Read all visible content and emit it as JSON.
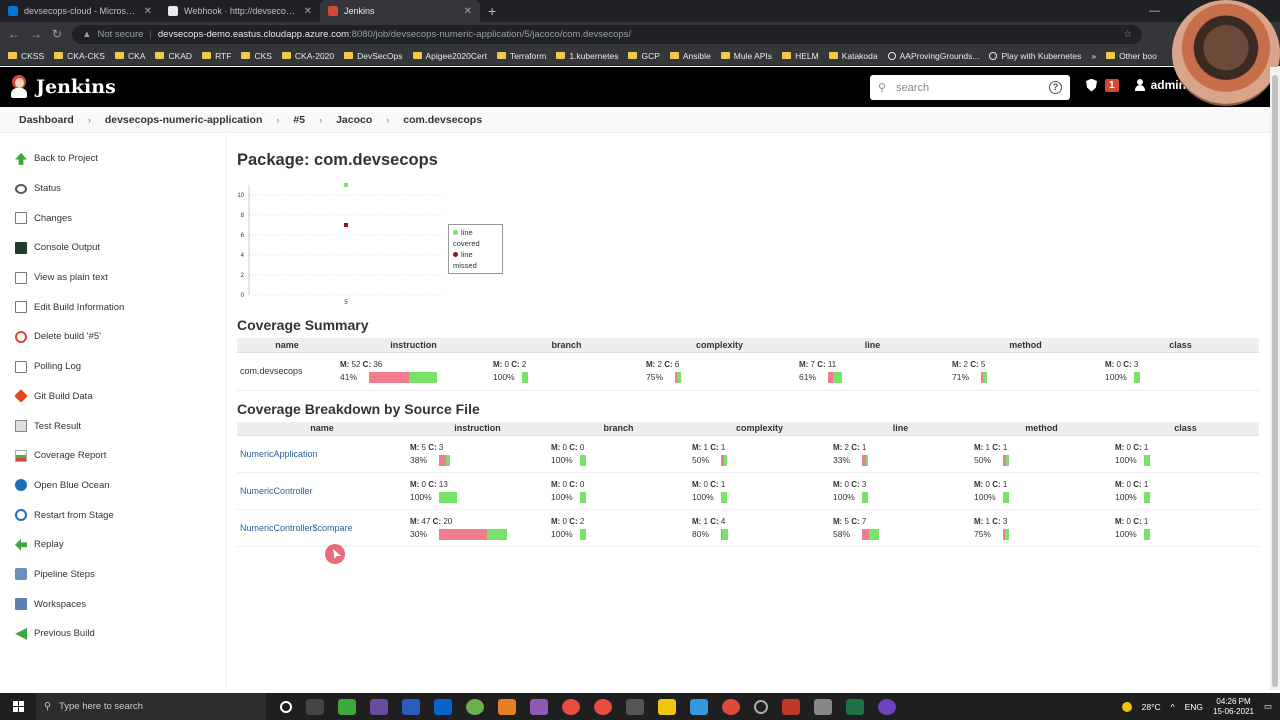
{
  "browser": {
    "tabs": [
      {
        "title": "devsecops-cloud - Microsoft Az",
        "color": "#0078d4",
        "active": false
      },
      {
        "title": "Webhook · http://devsecops-de",
        "color": "#e8eaed",
        "active": false
      },
      {
        "title": "Jenkins",
        "color": "#d24939",
        "active": true
      }
    ],
    "new_tab": "+",
    "security": "Not secure",
    "url_host": "devsecops-demo.eastus.cloudapp.azure.com",
    "url_path": ":8080/job/devsecops-numeric-application/5/jacoco/com.devsecops/",
    "bookmarks": [
      "CKSS",
      "CKA-CKS",
      "CKA",
      "CKAD",
      "RTF",
      "CKS",
      "CKA-2020",
      "DevSecOps",
      "Apigee2020Cert",
      "Terraform",
      "1.kubernetes",
      "GCP",
      "Ansible",
      "Mule APIs",
      "HELM",
      "Katakoda",
      "AAProvingGrounds...",
      "Play with Kubernetes"
    ],
    "bookmarks_more": "»",
    "bookmarks_other": "Other boo"
  },
  "jenkins": {
    "brand": "Jenkins",
    "search_placeholder": "search",
    "help": "?",
    "alerts_count": "1",
    "user": "admin"
  },
  "breadcrumb": [
    "Dashboard",
    "devsecops-numeric-application",
    "#5",
    "Jacoco",
    "com.devsecops"
  ],
  "breadcrumb_sep": "›",
  "sidebar": [
    {
      "label": "Back to Project",
      "icon": "i-arrow-up",
      "name": "arrow-up-icon"
    },
    {
      "label": "Status",
      "icon": "i-search",
      "name": "magnifier-icon"
    },
    {
      "label": "Changes",
      "icon": "i-doc",
      "name": "notepad-icon"
    },
    {
      "label": "Console Output",
      "icon": "i-console",
      "name": "terminal-icon"
    },
    {
      "label": "View as plain text",
      "icon": "i-doc",
      "name": "document-icon"
    },
    {
      "label": "Edit Build Information",
      "icon": "i-doc",
      "name": "notepad-icon"
    },
    {
      "label": "Delete build '#5'",
      "icon": "i-ban",
      "name": "no-entry-icon"
    },
    {
      "label": "Polling Log",
      "icon": "i-doc",
      "name": "document-icon"
    },
    {
      "label": "Git Build Data",
      "icon": "i-git",
      "name": "git-icon"
    },
    {
      "label": "Test Result",
      "icon": "i-clip",
      "name": "clipboard-icon"
    },
    {
      "label": "Coverage Report",
      "icon": "i-chart",
      "name": "coverage-chart-icon"
    },
    {
      "label": "Open Blue Ocean",
      "icon": "i-ocean",
      "name": "blue-ocean-icon"
    },
    {
      "label": "Restart from Stage",
      "icon": "i-restart",
      "name": "restart-icon"
    },
    {
      "label": "Replay",
      "icon": "i-replay",
      "name": "replay-icon"
    },
    {
      "label": "Pipeline Steps",
      "icon": "i-steps",
      "name": "pipeline-steps-icon"
    },
    {
      "label": "Workspaces",
      "icon": "i-folder",
      "name": "folder-icon"
    },
    {
      "label": "Previous Build",
      "icon": "i-prev",
      "name": "arrow-left-icon"
    }
  ],
  "page": {
    "title": "Package: com.devsecops",
    "summary_title": "Coverage Summary",
    "breakdown_title": "Coverage Breakdown by Source File",
    "columns": [
      "name",
      "instruction",
      "branch",
      "complexity",
      "line",
      "method",
      "class"
    ],
    "m_label": "M:",
    "c_label": "C:"
  },
  "chart_data": {
    "type": "scatter",
    "x": [
      "5"
    ],
    "series": [
      {
        "name": "line covered",
        "values": [
          11
        ],
        "color": "#78e36b"
      },
      {
        "name": "line missed",
        "values": [
          7
        ],
        "color": "#8b1a1a"
      }
    ],
    "y_ticks": [
      0,
      2,
      4,
      6,
      8,
      10
    ],
    "ylim": [
      0,
      11
    ]
  },
  "summary": [
    {
      "name": "com.devsecops",
      "cells": [
        {
          "m": "52",
          "c": "36",
          "pct": "41%",
          "covered": 0.41
        },
        {
          "m": "0",
          "c": "2",
          "pct": "100%",
          "covered": 1.0
        },
        {
          "m": "2",
          "c": "6",
          "pct": "75%",
          "covered": 0.75
        },
        {
          "m": "7",
          "c": "11",
          "pct": "61%",
          "covered": 0.61
        },
        {
          "m": "2",
          "c": "5",
          "pct": "71%",
          "covered": 0.71
        },
        {
          "m": "0",
          "c": "3",
          "pct": "100%",
          "covered": 1.0
        }
      ]
    }
  ],
  "breakdown": [
    {
      "name": "NumericApplication",
      "cells": [
        {
          "m": "5",
          "c": "3",
          "pct": "38%",
          "covered": 0.38
        },
        {
          "m": "0",
          "c": "0",
          "pct": "100%",
          "covered": 1.0
        },
        {
          "m": "1",
          "c": "1",
          "pct": "50%",
          "covered": 0.5
        },
        {
          "m": "2",
          "c": "1",
          "pct": "33%",
          "covered": 0.33
        },
        {
          "m": "1",
          "c": "1",
          "pct": "50%",
          "covered": 0.5
        },
        {
          "m": "0",
          "c": "1",
          "pct": "100%",
          "covered": 1.0
        }
      ]
    },
    {
      "name": "NumericController",
      "cells": [
        {
          "m": "0",
          "c": "13",
          "pct": "100%",
          "covered": 1.0
        },
        {
          "m": "0",
          "c": "0",
          "pct": "100%",
          "covered": 1.0
        },
        {
          "m": "0",
          "c": "1",
          "pct": "100%",
          "covered": 1.0
        },
        {
          "m": "0",
          "c": "3",
          "pct": "100%",
          "covered": 1.0
        },
        {
          "m": "0",
          "c": "1",
          "pct": "100%",
          "covered": 1.0
        },
        {
          "m": "0",
          "c": "1",
          "pct": "100%",
          "covered": 1.0
        }
      ]
    },
    {
      "name": "NumericController$compare",
      "cells": [
        {
          "m": "47",
          "c": "20",
          "pct": "30%",
          "covered": 0.3
        },
        {
          "m": "0",
          "c": "2",
          "pct": "100%",
          "covered": 1.0
        },
        {
          "m": "1",
          "c": "4",
          "pct": "80%",
          "covered": 0.8
        },
        {
          "m": "5",
          "c": "7",
          "pct": "58%",
          "covered": 0.58
        },
        {
          "m": "1",
          "c": "3",
          "pct": "75%",
          "covered": 0.75
        },
        {
          "m": "0",
          "c": "1",
          "pct": "100%",
          "covered": 1.0
        }
      ]
    }
  ],
  "taskbar": {
    "search_placeholder": "Type here to search",
    "temperature": "28°C",
    "lang": "ENG",
    "time": "04:26 PM",
    "date": "15-06-2021"
  }
}
